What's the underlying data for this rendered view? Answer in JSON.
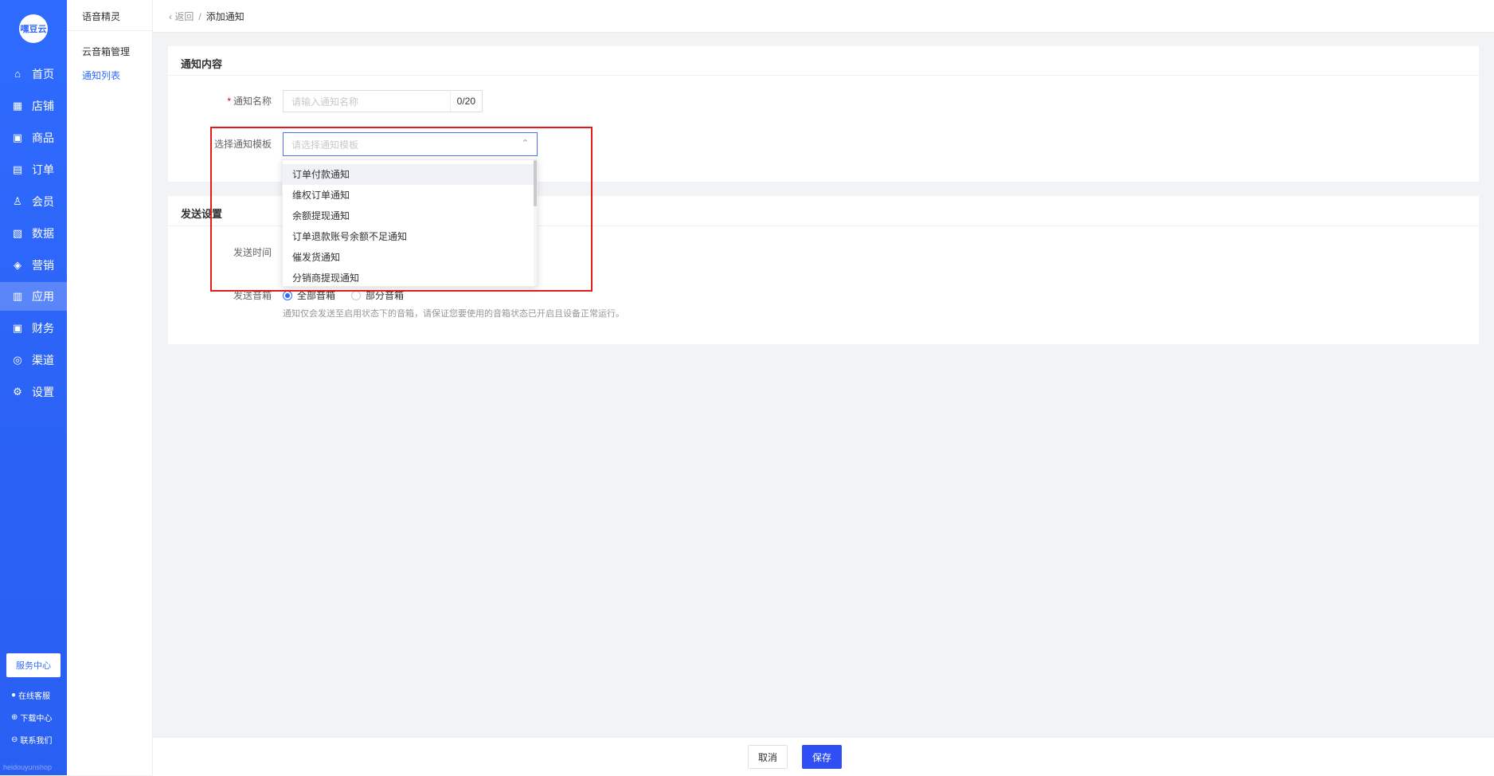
{
  "brand": {
    "logo_text": "嘿豆云"
  },
  "nav": {
    "items": [
      {
        "label": "首页",
        "icon": "home-icon",
        "glyph": "⌂"
      },
      {
        "label": "店铺",
        "icon": "store-icon",
        "glyph": "▦"
      },
      {
        "label": "商品",
        "icon": "goods-icon",
        "glyph": "▣"
      },
      {
        "label": "订单",
        "icon": "order-icon",
        "glyph": "▤"
      },
      {
        "label": "会员",
        "icon": "member-icon",
        "glyph": "♙"
      },
      {
        "label": "数据",
        "icon": "data-icon",
        "glyph": "▧"
      },
      {
        "label": "营销",
        "icon": "marketing-tag-icon",
        "glyph": "◈"
      },
      {
        "label": "应用",
        "icon": "app-icon",
        "glyph": "▥",
        "active": true
      },
      {
        "label": "财务",
        "icon": "finance-icon",
        "glyph": "▣"
      },
      {
        "label": "渠道",
        "icon": "channel-icon",
        "glyph": "◎"
      },
      {
        "label": "设置",
        "icon": "settings-gear-icon",
        "glyph": "⚙"
      }
    ],
    "service_center": "服务中心",
    "links": [
      {
        "label": "在线客服",
        "icon": "customer-service-icon",
        "glyph": "●"
      },
      {
        "label": "下载中心",
        "icon": "download-icon",
        "glyph": "⊕"
      },
      {
        "label": "联系我们",
        "icon": "contact-icon",
        "glyph": "⊖"
      }
    ],
    "domain": "heidouyunshop"
  },
  "subnav": {
    "title": "语音精灵",
    "items": [
      {
        "label": "云音箱管理"
      },
      {
        "label": "通知列表",
        "active": true
      }
    ]
  },
  "breadcrumb": {
    "back": "返回",
    "sep": "/",
    "current": "添加通知"
  },
  "notice_card": {
    "title": "通知内容",
    "name_label": "通知名称",
    "name_required": "*",
    "name_placeholder": "请输入通知名称",
    "name_count": "0/20",
    "template_label": "选择通知模板",
    "template_placeholder": "请选择通知模板",
    "template_options": [
      "订单付款通知",
      "维权订单通知",
      "余额提现通知",
      "订单退款账号余额不足通知",
      "催发货通知",
      "分销商提现通知"
    ]
  },
  "send_card": {
    "title": "发送设置",
    "time_label": "发送时间",
    "speaker_label": "发送音箱",
    "options": [
      {
        "label": "全部音箱",
        "checked": true
      },
      {
        "label": "部分音箱",
        "checked": false
      }
    ],
    "hint": "通知仅会发送至启用状态下的音箱，请保证您要使用的音箱状态已开启且设备正常运行。"
  },
  "footer": {
    "cancel": "取消",
    "save": "保存"
  }
}
